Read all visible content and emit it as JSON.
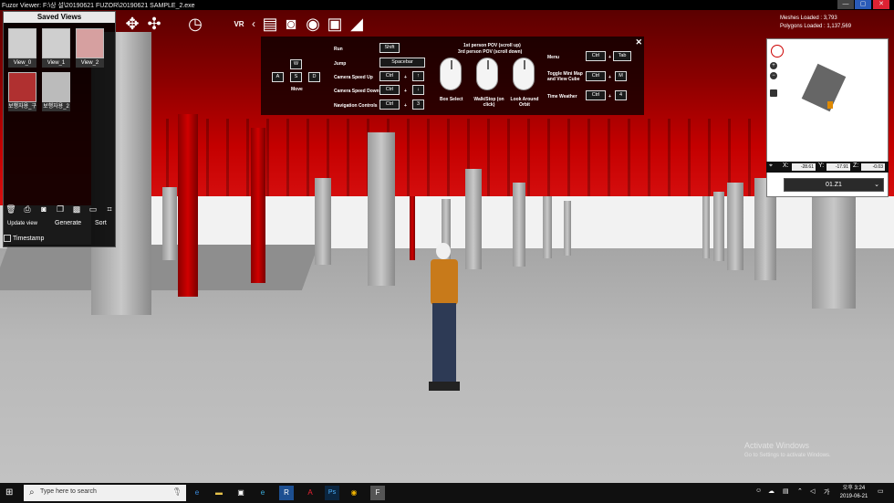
{
  "window": {
    "title": "Fuzor Viewer: F:\\상 설\\20190621 FUZOR\\20190621 SAMPLE_2.exe",
    "controls": [
      "—",
      "▢",
      "✕"
    ]
  },
  "toolbar": {
    "tools": [
      {
        "name": "move-icon",
        "glyph": "✥"
      },
      {
        "name": "walk-icon",
        "glyph": "✣"
      },
      {
        "name": "clock-icon",
        "glyph": "◷"
      },
      {
        "name": "vr-icon",
        "glyph": "VR"
      },
      {
        "name": "chevron-left-icon",
        "glyph": "‹"
      },
      {
        "name": "clipboard-icon",
        "glyph": "▤"
      },
      {
        "name": "camera-icon",
        "glyph": "◙"
      },
      {
        "name": "eye-icon",
        "glyph": "◉"
      },
      {
        "name": "document-icon",
        "glyph": "▣"
      },
      {
        "name": "measure-icon",
        "glyph": "◢"
      }
    ]
  },
  "saved_views": {
    "title": "Saved Views",
    "thumbs": [
      {
        "label": "View_0"
      },
      {
        "label": "View_1"
      },
      {
        "label": "View_2"
      },
      {
        "label": "보행자용_구"
      },
      {
        "label": "보행자용_2"
      }
    ],
    "tools": [
      {
        "name": "delete-icon",
        "glyph": "🗑"
      },
      {
        "name": "print-icon",
        "glyph": "⎙"
      },
      {
        "name": "camera-icon",
        "glyph": "◙"
      },
      {
        "name": "copy-icon",
        "glyph": "❐"
      },
      {
        "name": "save-icon",
        "glyph": "▩"
      },
      {
        "name": "folder-icon",
        "glyph": "▭"
      },
      {
        "name": "crop-icon",
        "glyph": "⌗"
      }
    ],
    "update_label": "Update view",
    "generate_label": "Generate",
    "sort_label": "Sort",
    "timestamp_label": "Timestamp"
  },
  "help": {
    "move_label": "Move",
    "keys": {
      "w": "W",
      "a": "A",
      "s": "S",
      "d": "D"
    },
    "rows": [
      {
        "label": "Run",
        "keys": [
          "Shift"
        ]
      },
      {
        "label": "Jump",
        "keys": [
          "Spacebar"
        ]
      },
      {
        "label": "Camera Speed Up",
        "keys": [
          "Ctrl",
          "+",
          "↑"
        ]
      },
      {
        "label": "Camera Speed Down",
        "keys": [
          "Ctrl",
          "+",
          "↓"
        ]
      },
      {
        "label": "Navigation Controls",
        "keys": [
          "Ctrl",
          "+",
          "3"
        ]
      }
    ],
    "pov1": "1st person POV (scroll up)",
    "pov3": "3rd person POV (scroll down)",
    "mice": [
      "Box Select",
      "Walk/Stop (on click)",
      "Look Around Orbit"
    ],
    "right_rows": [
      {
        "label": "Menu",
        "keys": [
          "Ctrl",
          "+",
          "Tab"
        ]
      },
      {
        "label": "Toggle Mini Map and View Cube",
        "keys": [
          "Ctrl",
          "+",
          "M"
        ]
      },
      {
        "label": "Time Weather",
        "keys": [
          "Ctrl",
          "+",
          "4"
        ]
      }
    ],
    "close": "✕"
  },
  "stats": {
    "meshes": "Meshes Loaded : 3,793",
    "polygons": "Polygons Loaded : 1,137,569"
  },
  "minimap": {
    "x_label": "X:",
    "x_value": "-28.61",
    "y_label": "Y:",
    "y_value": "-17.91",
    "z_label": "Z:",
    "z_value": "-0.03",
    "level": "01.Z1"
  },
  "watermark": {
    "title": "Activate Windows",
    "subtitle": "Go to Settings to activate Windows."
  },
  "taskbar": {
    "search_placeholder": "Type here to search",
    "apps": [
      {
        "name": "task-view-icon",
        "glyph": "⧉"
      },
      {
        "name": "edge-icon",
        "glyph": "e"
      },
      {
        "name": "explorer-icon",
        "glyph": "▬"
      },
      {
        "name": "store-icon",
        "glyph": "▣"
      },
      {
        "name": "ie-icon",
        "glyph": "e"
      },
      {
        "name": "revit-icon",
        "glyph": "R"
      },
      {
        "name": "acrobat-icon",
        "glyph": "A"
      },
      {
        "name": "photoshop-icon",
        "glyph": "Ps"
      },
      {
        "name": "chrome-icon",
        "glyph": "◉"
      },
      {
        "name": "fuzor-icon",
        "glyph": "F"
      }
    ],
    "time": "오후 3:24",
    "date": "2019-06-21"
  },
  "colors": {
    "ceiling_red": "#c40000",
    "accent_blue": "#2a5bb8"
  }
}
